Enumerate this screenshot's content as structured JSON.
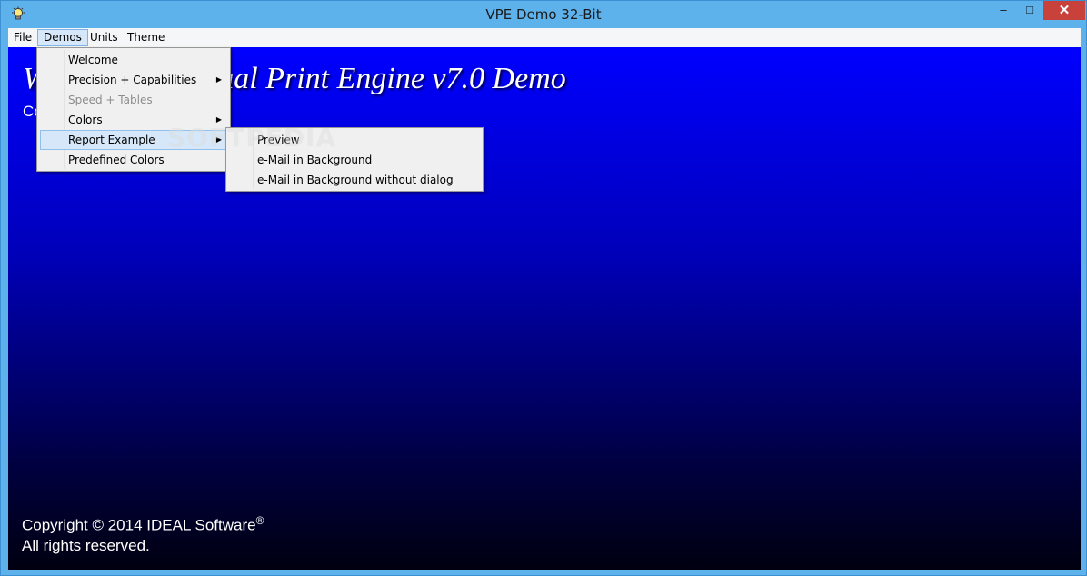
{
  "window": {
    "title": "VPE Demo 32-Bit",
    "controls": {
      "minimize": "–",
      "maximize": "□",
      "close": "✕"
    }
  },
  "menubar": {
    "items": [
      {
        "label": "File"
      },
      {
        "label": "Demos"
      },
      {
        "label": "Units"
      },
      {
        "label": "Theme"
      }
    ]
  },
  "demos_menu": {
    "items": [
      {
        "label": "Welcome",
        "submenu": false,
        "enabled": true
      },
      {
        "label": "Precision + Capabilities",
        "submenu": true,
        "enabled": true
      },
      {
        "label": "Speed + Tables",
        "submenu": false,
        "enabled": false
      },
      {
        "label": "Colors",
        "submenu": true,
        "enabled": true
      },
      {
        "label": "Report Example",
        "submenu": true,
        "enabled": true,
        "highlighted": true
      },
      {
        "label": "Predefined Colors",
        "submenu": false,
        "enabled": true
      }
    ]
  },
  "report_submenu": {
    "items": [
      {
        "label": "Preview"
      },
      {
        "label": "e-Mail in Background"
      },
      {
        "label": "e-Mail in Background without dialog"
      }
    ]
  },
  "content": {
    "title": "Welcome to Virtual Print Engine v7.0 Demo",
    "subtitle": "Copyright",
    "copyright_line": "Copyright © 2014 IDEAL Software",
    "registered_mark": "®",
    "rights": "All rights reserved."
  },
  "watermark": "SOFTPEDIA",
  "colors": {
    "titlebar": "#5eb2ec",
    "close_button": "#c8413a",
    "menu_highlight": "#d5e7f8",
    "gradient_top": "#0000ff",
    "gradient_bottom": "#000010"
  }
}
